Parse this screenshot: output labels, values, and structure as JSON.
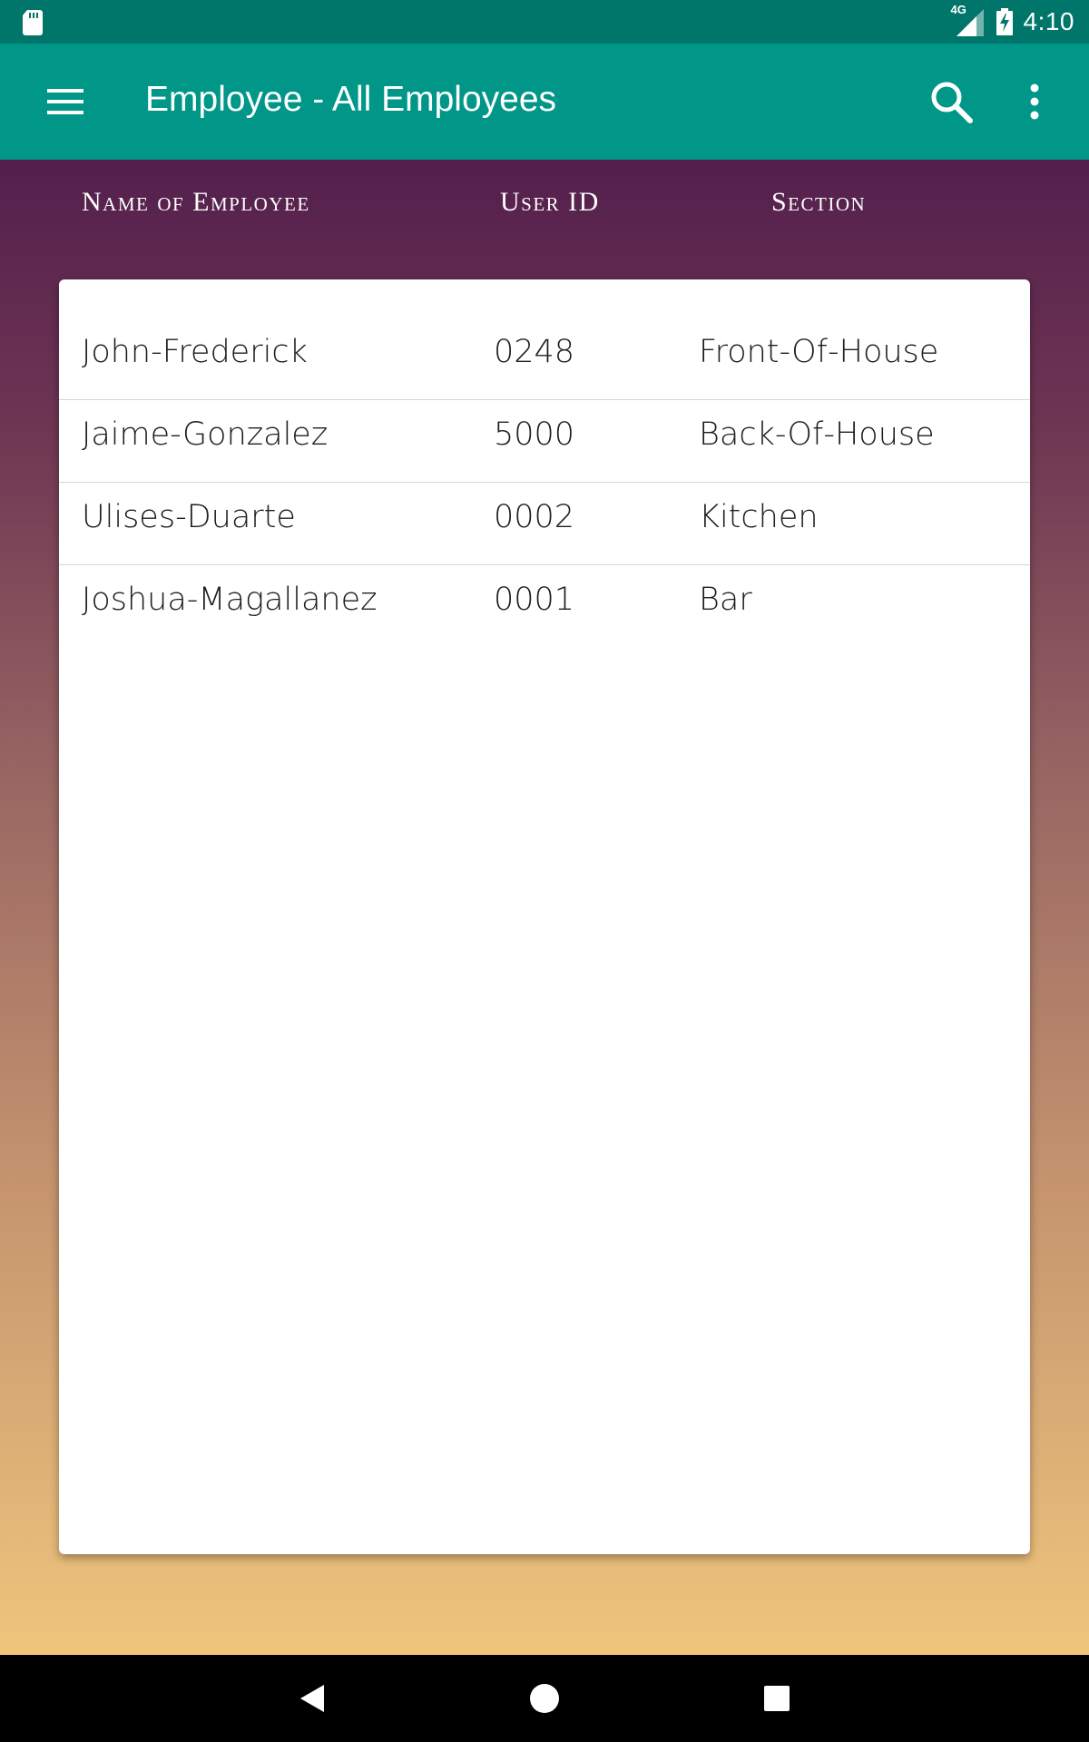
{
  "status_bar": {
    "network": "4G",
    "time": "4:10",
    "icons": [
      "sd-card-icon",
      "signal-icon",
      "battery-charging-icon"
    ]
  },
  "app_bar": {
    "title": "Employee - All Employees",
    "icons": [
      "menu-icon",
      "search-icon",
      "more-vert-icon"
    ]
  },
  "table": {
    "headers": [
      "Name of Employee",
      "User ID",
      "Section"
    ],
    "rows": [
      {
        "name": "John-Frederick",
        "user_id": "0248",
        "section": "Front-Of-House"
      },
      {
        "name": "Jaime-Gonzalez",
        "user_id": "5000",
        "section": "Back-Of-House"
      },
      {
        "name": "Ulises-Duarte",
        "user_id": "0002",
        "section": "Kitchen"
      },
      {
        "name": "Joshua-Magallanez",
        "user_id": "0001",
        "section": "Bar"
      }
    ]
  },
  "nav_bar": {
    "icons": [
      "back-icon",
      "home-icon",
      "recents-icon"
    ]
  },
  "colors": {
    "status_bar": "#00766a",
    "app_bar": "#009688",
    "gradient_top": "#531f4d",
    "gradient_bottom": "#efc57c",
    "card": "#ffffff"
  }
}
